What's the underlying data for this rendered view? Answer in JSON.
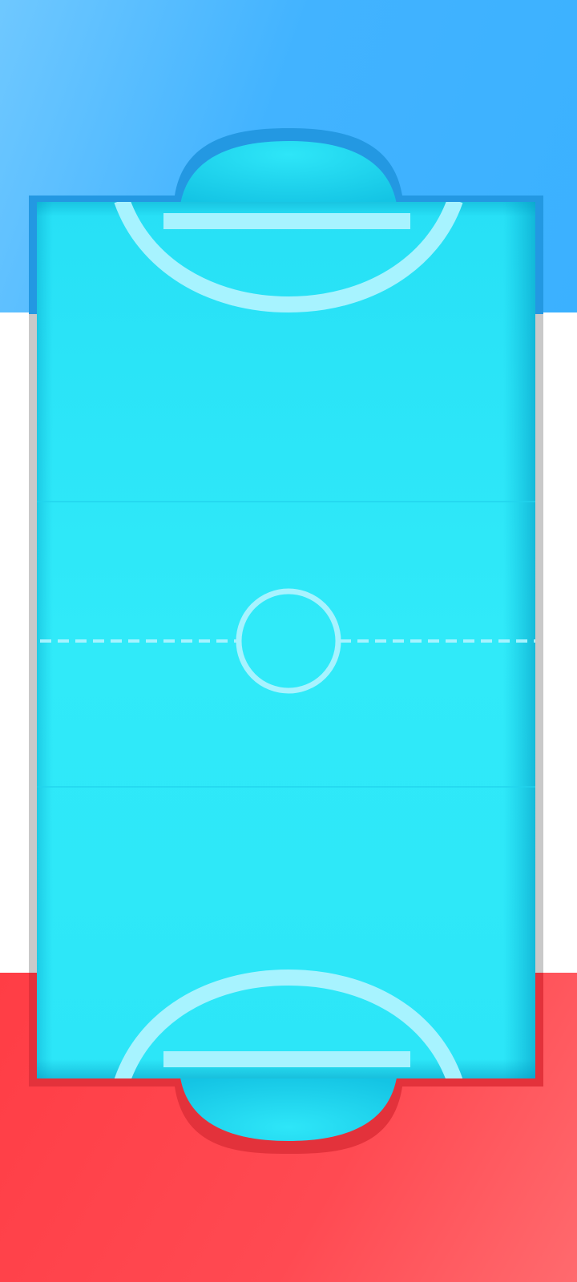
{
  "game": {
    "players": [
      {
        "side": "top",
        "color": "#3bb1ff"
      },
      {
        "side": "bottom",
        "color": "#ff4048"
      }
    ]
  },
  "colors": {
    "table_surface": "#2ee6f8",
    "table_surface_shade": "#12c6e6",
    "line": "#a7f3ff",
    "rail_top": "#2396e0",
    "rail_bottom": "#e3313a",
    "rail_side": "#c8c8c8"
  }
}
